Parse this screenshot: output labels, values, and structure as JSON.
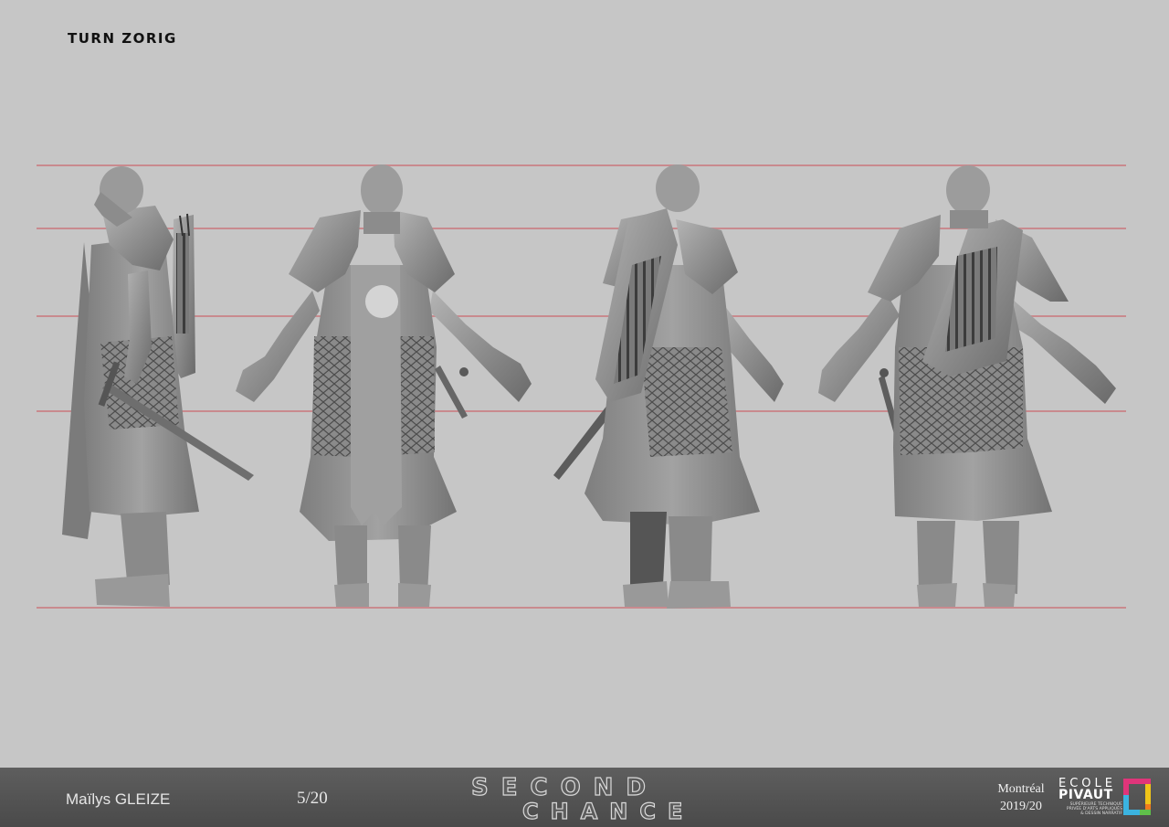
{
  "title": "TURN ZORIG",
  "views": [
    "side-left",
    "front",
    "back-three-quarter",
    "back"
  ],
  "colors": {
    "background": "#c6c6c6",
    "guide_line": "#c98a8e",
    "footer": "#555555",
    "model_shade": "#8f8f8f"
  },
  "footer": {
    "author": "Maïlys GLEIZE",
    "page": "5/20",
    "game_logo": {
      "line1": "SECOND",
      "line2": "CHANCE"
    },
    "city": "Montréal",
    "year": "2019/20",
    "school": {
      "name_top": "ECOLE",
      "name_main": "PIVAUT",
      "subtitle": [
        "SUPÉRIEURE TECHNIQUE",
        "PRIVÉE D'ARTS APPLIQUÉS",
        "& DESSIN NARRATIF"
      ]
    }
  }
}
